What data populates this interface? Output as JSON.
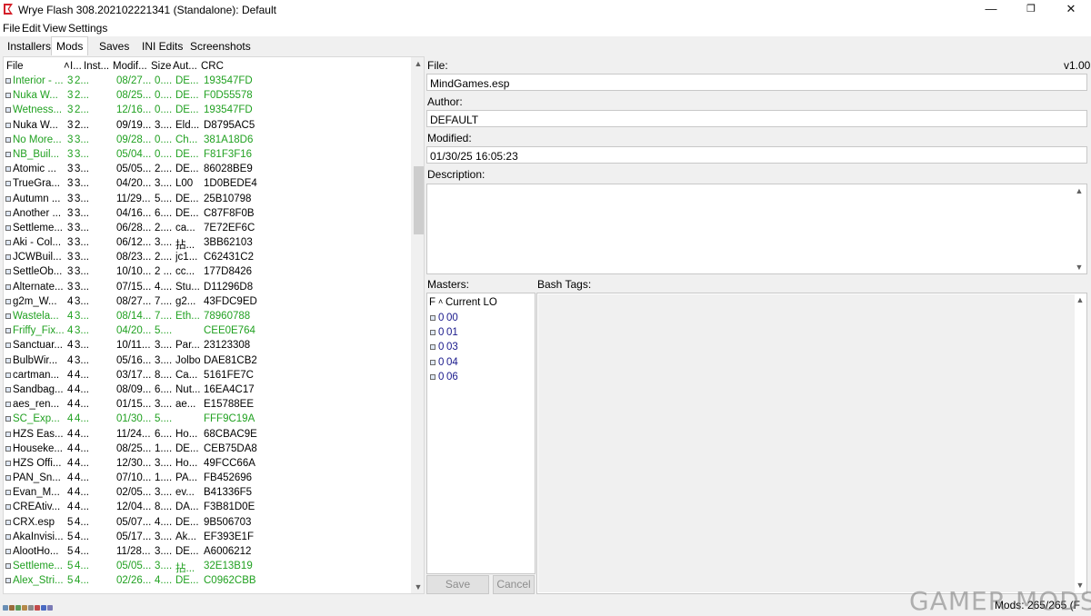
{
  "window": {
    "title": "Wrye Flash 308.202102221341 (Standalone): Default",
    "minimize": "—",
    "restore": "❐",
    "close": "✕"
  },
  "menu": [
    "File",
    "Edit",
    "View",
    "Settings"
  ],
  "tabs": [
    "Installers",
    "Mods",
    "Saves",
    "INI Edits",
    "Screenshots"
  ],
  "active_tab": "Mods",
  "columns": [
    "File",
    "˄",
    "I...",
    "Inst...",
    "Modif...",
    "Size",
    "Aut...",
    "CRC"
  ],
  "mods": [
    {
      "file": "Interior - ...",
      "i": "3",
      "inst": "2...",
      "mod": "08/27...",
      "size": "0....",
      "auth": "DE...",
      "crc": "193547FD",
      "green": true
    },
    {
      "file": "Nuka W...",
      "i": "3",
      "inst": "2...",
      "mod": "08/25...",
      "size": "0....",
      "auth": "DE...",
      "crc": "F0D55578",
      "green": true
    },
    {
      "file": "Wetness...",
      "i": "3",
      "inst": "2...",
      "mod": "12/16...",
      "size": "0....",
      "auth": "DE...",
      "crc": "193547FD",
      "green": true
    },
    {
      "file": "Nuka W...",
      "i": "3",
      "inst": "2...",
      "mod": "09/19...",
      "size": "3....",
      "auth": "Eld...",
      "crc": "D8795AC5",
      "green": false
    },
    {
      "file": "No More...",
      "i": "3",
      "inst": "3...",
      "mod": "09/28...",
      "size": "0....",
      "auth": "Ch...",
      "crc": "381A18D6",
      "green": true
    },
    {
      "file": "NB_Buil...",
      "i": "3",
      "inst": "3...",
      "mod": "05/04...",
      "size": "0....",
      "auth": "DE...",
      "crc": "F81F3F16",
      "green": true
    },
    {
      "file": "Atomic ...",
      "i": "3",
      "inst": "3...",
      "mod": "05/05...",
      "size": "2....",
      "auth": "DE...",
      "crc": "86028BE9",
      "green": false
    },
    {
      "file": "TrueGra...",
      "i": "3",
      "inst": "3...",
      "mod": "04/20...",
      "size": "3....",
      "auth": "L00",
      "crc": "1D0BEDE4",
      "green": false
    },
    {
      "file": "Autumn ...",
      "i": "3",
      "inst": "3...",
      "mod": "11/29...",
      "size": "5....",
      "auth": "DE...",
      "crc": "25B10798",
      "green": false
    },
    {
      "file": "Another ...",
      "i": "3",
      "inst": "3...",
      "mod": "04/16...",
      "size": "6....",
      "auth": "DE...",
      "crc": "C87F8F0B",
      "green": false
    },
    {
      "file": "Settleme...",
      "i": "3",
      "inst": "3...",
      "mod": "06/28...",
      "size": "2....",
      "auth": "ca...",
      "crc": "7E72EF6C",
      "green": false
    },
    {
      "file": "Aki - Col...",
      "i": "3",
      "inst": "3...",
      "mod": "06/12...",
      "size": "3....",
      "auth": "拈...",
      "crc": "3BB62103",
      "green": false
    },
    {
      "file": "JCWBuil...",
      "i": "3",
      "inst": "3...",
      "mod": "08/23...",
      "size": "2....",
      "auth": "jc1...",
      "crc": "C62431C2",
      "green": false
    },
    {
      "file": "SettleOb...",
      "i": "3",
      "inst": "3...",
      "mod": "10/10...",
      "size": "2 ...",
      "auth": "cc...",
      "crc": "177D8426",
      "green": false
    },
    {
      "file": "Alternate...",
      "i": "3",
      "inst": "3...",
      "mod": "07/15...",
      "size": "4....",
      "auth": "Stu...",
      "crc": "D11296D8",
      "green": false
    },
    {
      "file": "g2m_W...",
      "i": "4",
      "inst": "3...",
      "mod": "08/27...",
      "size": "7....",
      "auth": "g2...",
      "crc": "43FDC9ED",
      "green": false
    },
    {
      "file": "Wastela...",
      "i": "4",
      "inst": "3...",
      "mod": "08/14...",
      "size": "7....",
      "auth": "Eth...",
      "crc": "78960788",
      "green": true
    },
    {
      "file": "Friffy_Fix...",
      "i": "4",
      "inst": "3...",
      "mod": "04/20...",
      "size": "5....",
      "auth": "",
      "crc": "CEE0E764",
      "green": true
    },
    {
      "file": "Sanctuar...",
      "i": "4",
      "inst": "3...",
      "mod": "10/11...",
      "size": "3....",
      "auth": "Par...",
      "crc": "23123308",
      "green": false
    },
    {
      "file": "BulbWir...",
      "i": "4",
      "inst": "3...",
      "mod": "05/16...",
      "size": "3....",
      "auth": "Jolbo",
      "crc": "DAE81CB2",
      "green": false
    },
    {
      "file": "cartman...",
      "i": "4",
      "inst": "4...",
      "mod": "03/17...",
      "size": "8....",
      "auth": "Ca...",
      "crc": "5161FE7C",
      "green": false
    },
    {
      "file": "Sandbag...",
      "i": "4",
      "inst": "4...",
      "mod": "08/09...",
      "size": "6....",
      "auth": "Nut...",
      "crc": "16EA4C17",
      "green": false
    },
    {
      "file": "aes_ren...",
      "i": "4",
      "inst": "4...",
      "mod": "01/15...",
      "size": "3....",
      "auth": "ae...",
      "crc": "E15788EE",
      "green": false
    },
    {
      "file": "SC_Exp...",
      "i": "4",
      "inst": "4...",
      "mod": "01/30...",
      "size": "5....",
      "auth": "",
      "crc": "FFF9C19A",
      "green": true
    },
    {
      "file": "HZS Eas...",
      "i": "4",
      "inst": "4...",
      "mod": "11/24...",
      "size": "6....",
      "auth": "Ho...",
      "crc": "68CBAC9E",
      "green": false
    },
    {
      "file": "Houseke...",
      "i": "4",
      "inst": "4...",
      "mod": "08/25...",
      "size": "1....",
      "auth": "DE...",
      "crc": "CEB75DA8",
      "green": false
    },
    {
      "file": "HZS Offi...",
      "i": "4",
      "inst": "4...",
      "mod": "12/30...",
      "size": "3....",
      "auth": "Ho...",
      "crc": "49FCC66A",
      "green": false
    },
    {
      "file": "PAN_Sn...",
      "i": "4",
      "inst": "4...",
      "mod": "07/10...",
      "size": "1....",
      "auth": "PA...",
      "crc": "FB452696",
      "green": false
    },
    {
      "file": "Evan_M...",
      "i": "4",
      "inst": "4...",
      "mod": "02/05...",
      "size": "3....",
      "auth": "ev...",
      "crc": "B41336F5",
      "green": false
    },
    {
      "file": "CREAtiv...",
      "i": "4",
      "inst": "4...",
      "mod": "12/04...",
      "size": "8....",
      "auth": "DA...",
      "crc": "F3B81D0E",
      "green": false
    },
    {
      "file": "CRX.esp",
      "i": "5",
      "inst": "4...",
      "mod": "05/07...",
      "size": "4....",
      "auth": "DE...",
      "crc": "9B506703",
      "green": false
    },
    {
      "file": "AkaInvisi...",
      "i": "5",
      "inst": "4...",
      "mod": "05/17...",
      "size": "3....",
      "auth": "Ak...",
      "crc": "EF393E1F",
      "green": false
    },
    {
      "file": "AlootHo...",
      "i": "5",
      "inst": "4...",
      "mod": "11/28...",
      "size": "3....",
      "auth": "DE...",
      "crc": "A6006212",
      "green": false
    },
    {
      "file": "Settleme...",
      "i": "5",
      "inst": "4...",
      "mod": "05/05...",
      "size": "3....",
      "auth": "拈...",
      "crc": "32E13B19",
      "green": true
    },
    {
      "file": "Alex_Stri...",
      "i": "5",
      "inst": "4...",
      "mod": "02/26...",
      "size": "4....",
      "auth": "DE...",
      "crc": "C0962CBB",
      "green": true
    }
  ],
  "details": {
    "file_label": "File:",
    "version": "v1.00",
    "file_value": "MindGames.esp",
    "author_label": "Author:",
    "author_value": "DEFAULT",
    "modified_label": "Modified:",
    "modified_value": "01/30/25 16:05:23",
    "description_label": "Description:",
    "masters_label": "Masters:",
    "bash_tags_label": "Bash Tags:",
    "masters_header_f": "F",
    "masters_header_sort": "˄",
    "masters_header_lo": "Current LO",
    "masters": [
      {
        "f": "0",
        "lo": "00"
      },
      {
        "f": "0",
        "lo": "01"
      },
      {
        "f": "0",
        "lo": "03"
      },
      {
        "f": "0",
        "lo": "04"
      },
      {
        "f": "0",
        "lo": "06"
      }
    ],
    "save_label": "Save",
    "cancel_label": "Cancel"
  },
  "status": {
    "mods_count": "Mods: 265/265 (F"
  },
  "watermark": "GAMER MODS",
  "colors": {
    "installed_green": "#21a121",
    "master_blue": "#1a1a8c"
  }
}
